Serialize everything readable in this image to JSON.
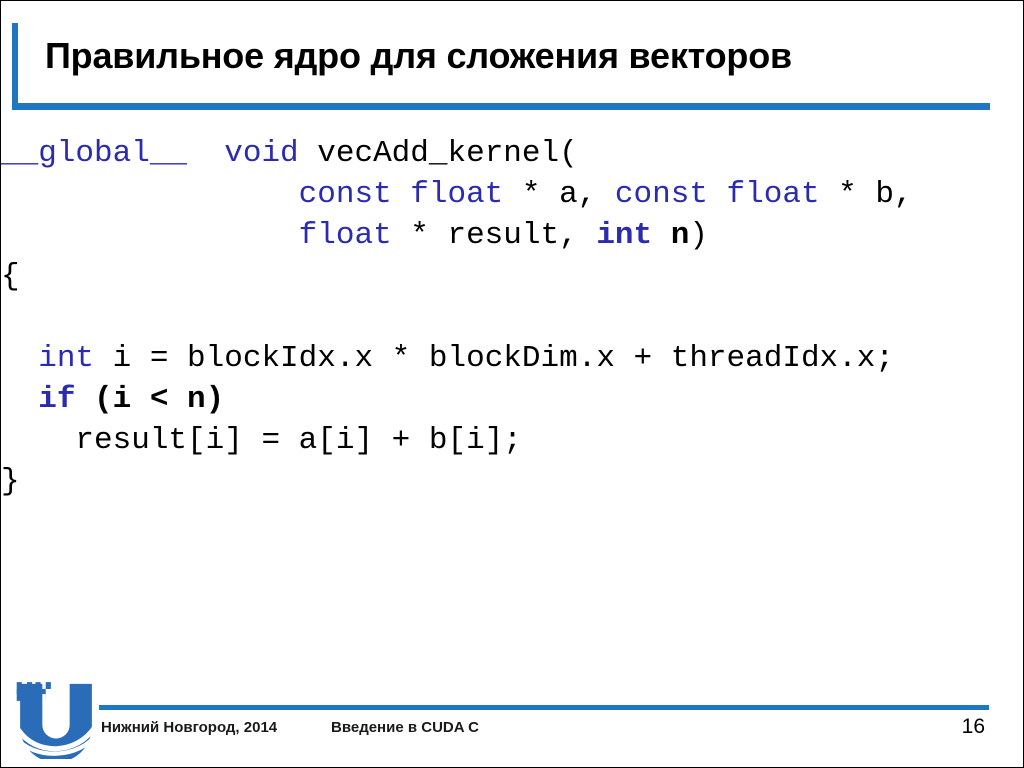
{
  "slide": {
    "title": "Правильное ядро для сложения векторов",
    "accent_color": "#1F77C4",
    "keyword_color": "#2B2BB0",
    "text_color": "#000000",
    "page_number": "16"
  },
  "code": {
    "lines": [
      {
        "indent": 0,
        "tokens": [
          {
            "text": "__global__",
            "style": "keyword"
          },
          {
            "text": "  ",
            "style": "plain"
          },
          {
            "text": "void",
            "style": "keyword"
          },
          {
            "text": " vecAdd_kernel(",
            "style": "plain"
          }
        ]
      },
      {
        "indent": 8,
        "tokens": [
          {
            "text": "const float",
            "style": "keyword"
          },
          {
            "text": " * a, ",
            "style": "plain"
          },
          {
            "text": "const float",
            "style": "keyword"
          },
          {
            "text": " * b,",
            "style": "plain"
          }
        ]
      },
      {
        "indent": 8,
        "tokens": [
          {
            "text": "float",
            "style": "keyword"
          },
          {
            "text": " * result, ",
            "style": "plain"
          },
          {
            "text": "int",
            "style": "keyword-bold"
          },
          {
            "text": " n",
            "style": "plain-bold"
          },
          {
            "text": ")",
            "style": "plain"
          }
        ]
      },
      {
        "indent": 0,
        "tokens": [
          {
            "text": "{",
            "style": "plain"
          }
        ]
      },
      {
        "indent": 0,
        "tokens": [
          {
            "text": "",
            "style": "plain"
          }
        ]
      },
      {
        "indent": 1,
        "tokens": [
          {
            "text": "int",
            "style": "keyword"
          },
          {
            "text": " i = blockIdx.x * blockDim.x + threadIdx.x;",
            "style": "plain"
          }
        ]
      },
      {
        "indent": 1,
        "tokens": [
          {
            "text": "if",
            "style": "keyword-bold"
          },
          {
            "text": " (i < n)",
            "style": "plain-bold"
          }
        ]
      },
      {
        "indent": 2,
        "tokens": [
          {
            "text": "result[i] = a[i] + b[i];",
            "style": "plain"
          }
        ]
      },
      {
        "indent": 0,
        "tokens": [
          {
            "text": "}",
            "style": "plain"
          }
        ]
      }
    ]
  },
  "footer": {
    "logo_alt": "unn-logo",
    "place": "Нижний Новгород, 2014",
    "course": "Введение в CUDA C"
  }
}
